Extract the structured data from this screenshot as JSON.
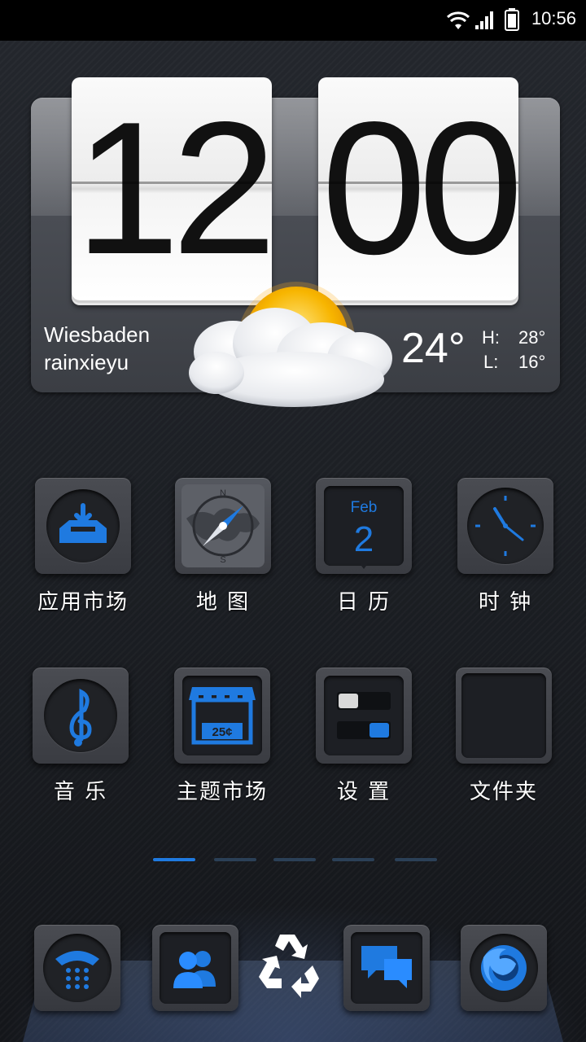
{
  "status_bar": {
    "time": "10:56",
    "icons": [
      "wifi-icon",
      "signal-icon",
      "battery-icon"
    ]
  },
  "clock_widget": {
    "hours": "12",
    "minutes": "00",
    "city": "Wiesbaden",
    "username": "rainxieyu",
    "temperature": "24°",
    "high_label": "H:",
    "high_value": "28°",
    "low_label": "L:",
    "low_value": "16°",
    "weather_icon": "partly-cloudy-icon"
  },
  "apps_row1": [
    {
      "label": "应用市场",
      "icon": "app-store-icon"
    },
    {
      "label": "地 图",
      "icon": "map-compass-icon"
    },
    {
      "label": "日 历",
      "icon": "calendar-icon"
    },
    {
      "label": "时 钟",
      "icon": "clock-icon"
    }
  ],
  "calendar_icon": {
    "month": "Feb",
    "day": "2"
  },
  "map_icon": {
    "north": "N",
    "south": "S"
  },
  "apps_row2": [
    {
      "label": "音 乐",
      "icon": "music-icon"
    },
    {
      "label": "主题市场",
      "icon": "theme-store-icon"
    },
    {
      "label": "设 置",
      "icon": "settings-toggle-icon"
    },
    {
      "label": "文件夹",
      "icon": "folder-icon"
    }
  ],
  "theme_icon": {
    "price": "25¢"
  },
  "page_indicator": {
    "pages": 5,
    "active": 1
  },
  "dock": [
    "phone-icon",
    "contacts-icon",
    "recycle-icon",
    "messages-icon",
    "firefox-icon"
  ],
  "colors": {
    "accent": "#1f7ae0",
    "background": "#1c1f24"
  }
}
